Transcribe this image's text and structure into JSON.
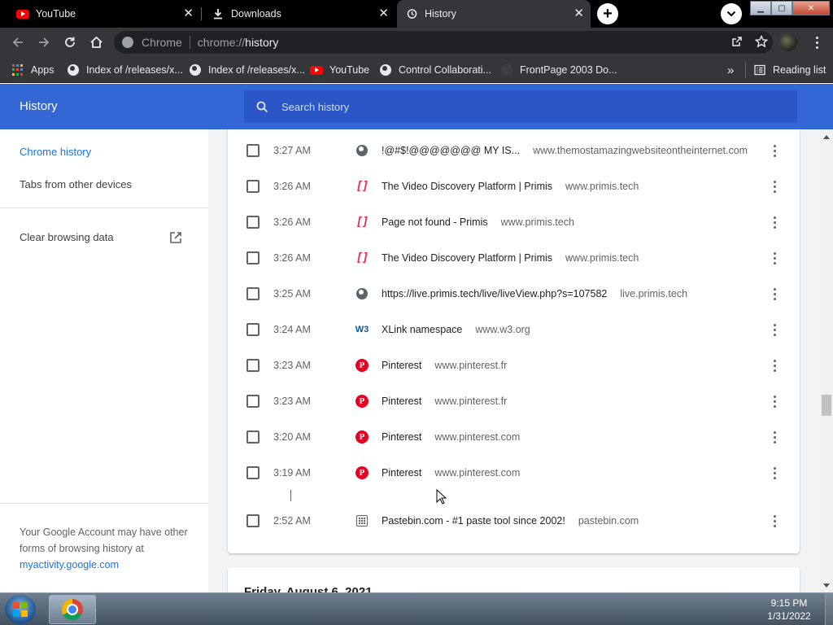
{
  "tabs": [
    {
      "title": "YouTube",
      "icon": "youtube-icon",
      "active": false
    },
    {
      "title": "Downloads",
      "icon": "download-icon",
      "active": false
    },
    {
      "title": "History",
      "icon": "history-icon",
      "active": true
    }
  ],
  "omnibox": {
    "site_label": "Chrome",
    "url_scheme": "chrome://",
    "url_path": "history"
  },
  "bookmarks": [
    {
      "label": "Apps",
      "icon": "apps-grid-icon"
    },
    {
      "label": "Index of /releases/x...",
      "icon": "globe-icon"
    },
    {
      "label": "Index of /releases/x...",
      "icon": "globe-icon"
    },
    {
      "label": "YouTube",
      "icon": "youtube-icon"
    },
    {
      "label": "Control Collaborati...",
      "icon": "globe-icon"
    },
    {
      "label": "FrontPage 2003 Do...",
      "icon": "blank-page-icon"
    }
  ],
  "bookmarks_overflow": "»",
  "reading_list": "Reading list",
  "header": {
    "title": "History",
    "search_placeholder": "Search history"
  },
  "sidebar": {
    "chrome_history": "Chrome history",
    "tabs_other_devices": "Tabs from other devices",
    "clear_browsing_data": "Clear browsing data",
    "footer_text": "Your Google Account may have other forms of browsing history at",
    "footer_link": "myactivity.google.com"
  },
  "history": [
    {
      "time": "3:27 AM",
      "title": "!@#$!@@@@@@@ MY IS...",
      "domain": "www.themostamazingwebsiteontheinternet.com",
      "favicon": "globe-icon"
    },
    {
      "time": "3:26 AM",
      "title": "The Video Discovery Platform | Primis",
      "domain": "www.primis.tech",
      "favicon": "primis-icon"
    },
    {
      "time": "3:26 AM",
      "title": "Page not found - Primis",
      "domain": "www.primis.tech",
      "favicon": "primis-icon"
    },
    {
      "time": "3:26 AM",
      "title": "The Video Discovery Platform | Primis",
      "domain": "www.primis.tech",
      "favicon": "primis-icon"
    },
    {
      "time": "3:25 AM",
      "title": "https://live.primis.tech/live/liveView.php?s=107582",
      "domain": "live.primis.tech",
      "favicon": "globe-icon"
    },
    {
      "time": "3:24 AM",
      "title": "XLink namespace",
      "domain": "www.w3.org",
      "favicon": "w3c-icon"
    },
    {
      "time": "3:23 AM",
      "title": "Pinterest",
      "domain": "www.pinterest.fr",
      "favicon": "pinterest-icon"
    },
    {
      "time": "3:23 AM",
      "title": "Pinterest",
      "domain": "www.pinterest.fr",
      "favicon": "pinterest-icon"
    },
    {
      "time": "3:20 AM",
      "title": "Pinterest",
      "domain": "www.pinterest.com",
      "favicon": "pinterest-icon"
    },
    {
      "time": "3:19 AM",
      "title": "Pinterest",
      "domain": "www.pinterest.com",
      "favicon": "pinterest-icon"
    },
    {
      "time": "2:52 AM",
      "title": "Pastebin.com - #1 paste tool since 2002!",
      "domain": "pastebin.com",
      "favicon": "pastebin-icon"
    }
  ],
  "next_date_heading": "Friday, August 6, 2021",
  "taskbar": {
    "time": "9:15 PM",
    "date": "1/31/2022"
  },
  "colors": {
    "header_blue": "#3367d6",
    "accent": "#1a73e8",
    "pinterest": "#e60023",
    "primis": "#e8294c"
  }
}
